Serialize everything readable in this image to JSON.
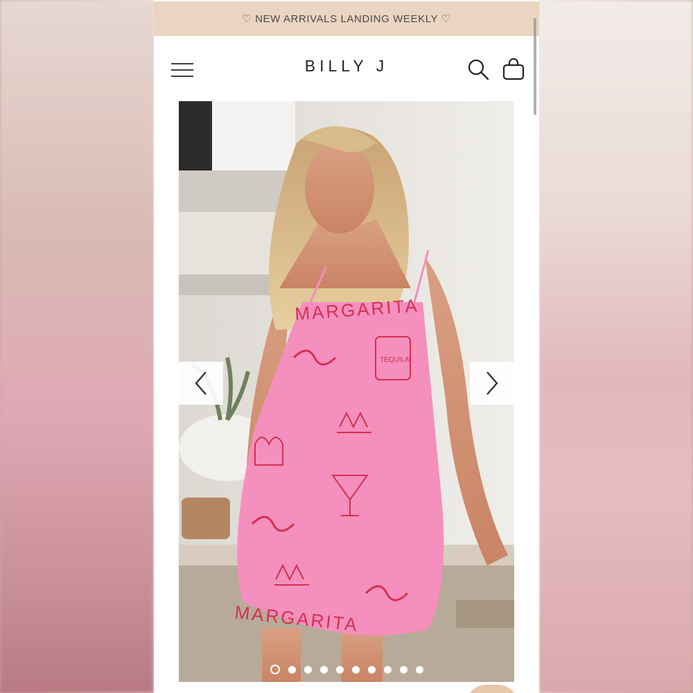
{
  "announcement": {
    "text": "♡ NEW ARRIVALS LANDING WEEKLY ♡"
  },
  "header": {
    "logo": "BILLY J",
    "menu_icon": "hamburger-menu-icon",
    "search_icon": "search-icon",
    "bag_icon": "shopping-bag-icon"
  },
  "gallery": {
    "print_words": [
      "MARGARITA",
      "MARGARITA",
      "TEQUILA"
    ],
    "dot_count": 10,
    "active_index": 0,
    "prev_icon": "chevron-left-icon",
    "next_icon": "chevron-right-icon"
  },
  "colors": {
    "announcement_bg": "#ead5c0",
    "dress_pink": "#f58fbd",
    "print_red": "#d3304f",
    "chat_bubble": "#e7c7a6"
  }
}
